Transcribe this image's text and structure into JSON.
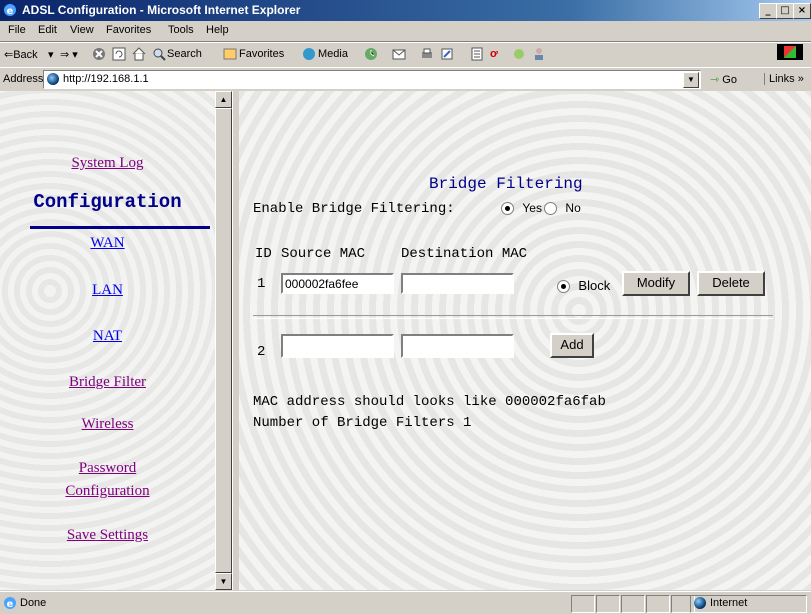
{
  "window": {
    "title": "ADSL Configuration - Microsoft Internet Explorer"
  },
  "window_buttons": {
    "minimize": "_",
    "maximize": "□",
    "close": "×"
  },
  "menubar": {
    "items": [
      "File",
      "Edit",
      "View",
      "Favorites",
      "Tools",
      "Help"
    ]
  },
  "toolbar": {
    "back": "⇐Back",
    "search": "Search",
    "favorites": "Favorites",
    "media": "Media"
  },
  "addressbar": {
    "label": "Address",
    "url": "http://192.168.1.1",
    "go": "Go",
    "links": "Links »"
  },
  "sidebar": {
    "system_log": "System Log",
    "section": "Configuration",
    "items": [
      "WAN",
      "LAN",
      "NAT",
      "Bridge Filter",
      "Wireless"
    ],
    "password_line1": "Password",
    "password_line2": "Configuration",
    "save": "Save Settings"
  },
  "content": {
    "title": "Bridge Filtering",
    "enable_label": "Enable Bridge Filtering:",
    "yes": "Yes",
    "no": "No",
    "enabled": "Yes",
    "headers": {
      "id": "ID",
      "source": "Source MAC",
      "dest": "Destination MAC"
    },
    "rows": [
      {
        "id": "1",
        "source": "000002fa6fee",
        "dest": "",
        "action": "Block",
        "modify": "Modify",
        "delete": "Delete"
      }
    ],
    "new_row": {
      "id": "2",
      "source": "",
      "dest": "",
      "add": "Add"
    },
    "hint": "MAC address should looks like 000002fa6fab",
    "count_text": "Number of Bridge Filters 1"
  },
  "statusbar": {
    "text": "Done",
    "zone": "Internet"
  },
  "colors": {
    "title_gradient_start": "#0a246a",
    "link": "#0000ee",
    "visited": "#800080",
    "heading": "#00008b"
  }
}
